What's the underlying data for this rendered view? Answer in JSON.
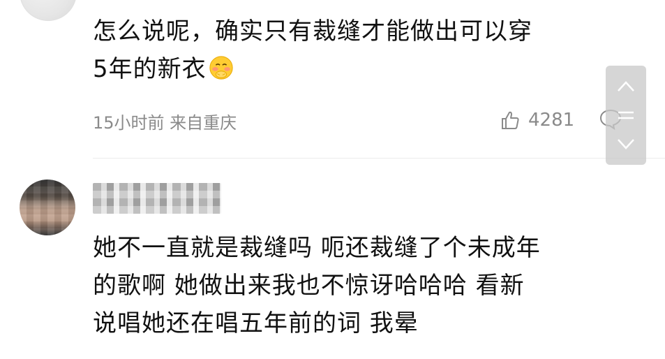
{
  "comments": [
    {
      "text_line1": "怎么说呢，确实只有裁缝才能做出可以穿",
      "text_line2": "5年的新衣",
      "emoji": "shy-face-emoji",
      "time": "15小时前",
      "location": "来自重庆",
      "meta": "15小时前 来自重庆",
      "likes": "4281"
    },
    {
      "username": "",
      "text_line1": "她不一直就是裁缝吗 呃还裁缝了个未成年",
      "text_line2": "的歌啊 她做出来我也不惊讶哈哈哈 看新",
      "text_line3": "说唱她还在唱五年前的词 我晕"
    }
  ],
  "icons": {
    "like": "thumbs-up-icon",
    "reply": "comment-bubble-icon",
    "scroll_up": "chevron-up-icon",
    "scroll_mid": "drag-handle-icon",
    "scroll_down": "chevron-down-icon"
  },
  "colors": {
    "meta_text": "#8a8a8a",
    "body_text": "#111111",
    "divider": "#ececec",
    "emoji_yellow": "#FFCC33"
  }
}
